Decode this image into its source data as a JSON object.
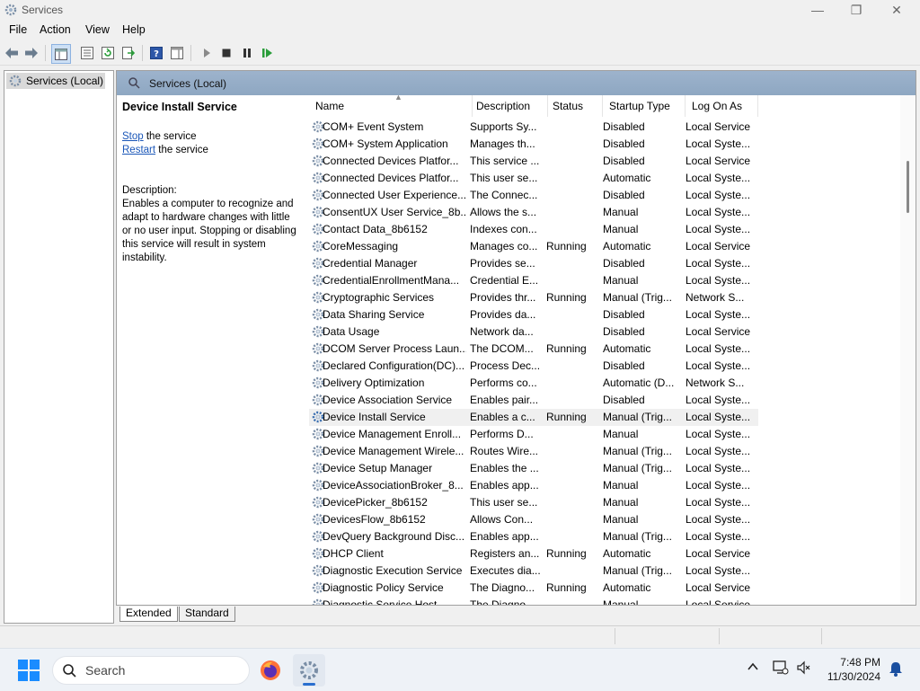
{
  "window": {
    "title": "Services",
    "controls": {
      "minimize": "—",
      "maximize": "❐",
      "close": "✕"
    }
  },
  "menu": [
    "File",
    "Action",
    "View",
    "Help"
  ],
  "tree": {
    "root": "Services (Local)"
  },
  "pane_header": "Services (Local)",
  "details": {
    "service_name": "Device Install Service",
    "stop_link": "Stop",
    "stop_suffix": " the service",
    "restart_link": "Restart",
    "restart_suffix": " the service",
    "description_label": "Description:",
    "description_text": "Enables a computer to recognize and adapt to hardware changes with little or no user input. Stopping or disabling this service will result in system instability."
  },
  "columns": [
    "Name",
    "Description",
    "Status",
    "Startup Type",
    "Log On As"
  ],
  "services": [
    {
      "name": "COM+ Event System",
      "desc": "Supports Sy...",
      "status": "",
      "startup": "Disabled",
      "logon": "Local Service"
    },
    {
      "name": "COM+ System Application",
      "desc": "Manages th...",
      "status": "",
      "startup": "Disabled",
      "logon": "Local Syste..."
    },
    {
      "name": "Connected Devices Platfor...",
      "desc": "This service ...",
      "status": "",
      "startup": "Disabled",
      "logon": "Local Service"
    },
    {
      "name": "Connected Devices Platfor...",
      "desc": "This user se...",
      "status": "",
      "startup": "Automatic",
      "logon": "Local Syste..."
    },
    {
      "name": "Connected User Experience...",
      "desc": "The Connec...",
      "status": "",
      "startup": "Disabled",
      "logon": "Local Syste..."
    },
    {
      "name": "ConsentUX User Service_8b...",
      "desc": "Allows the s...",
      "status": "",
      "startup": "Manual",
      "logon": "Local Syste..."
    },
    {
      "name": "Contact Data_8b6152",
      "desc": "Indexes con...",
      "status": "",
      "startup": "Manual",
      "logon": "Local Syste..."
    },
    {
      "name": "CoreMessaging",
      "desc": "Manages co...",
      "status": "Running",
      "startup": "Automatic",
      "logon": "Local Service"
    },
    {
      "name": "Credential Manager",
      "desc": "Provides se...",
      "status": "",
      "startup": "Disabled",
      "logon": "Local Syste..."
    },
    {
      "name": "CredentialEnrollmentMana...",
      "desc": "Credential E...",
      "status": "",
      "startup": "Manual",
      "logon": "Local Syste..."
    },
    {
      "name": "Cryptographic Services",
      "desc": "Provides thr...",
      "status": "Running",
      "startup": "Manual (Trig...",
      "logon": "Network S..."
    },
    {
      "name": "Data Sharing Service",
      "desc": "Provides da...",
      "status": "",
      "startup": "Disabled",
      "logon": "Local Syste..."
    },
    {
      "name": "Data Usage",
      "desc": "Network da...",
      "status": "",
      "startup": "Disabled",
      "logon": "Local Service"
    },
    {
      "name": "DCOM Server Process Laun...",
      "desc": "The DCOM...",
      "status": "Running",
      "startup": "Automatic",
      "logon": "Local Syste..."
    },
    {
      "name": "Declared Configuration(DC)...",
      "desc": "Process Dec...",
      "status": "",
      "startup": "Disabled",
      "logon": "Local Syste..."
    },
    {
      "name": "Delivery Optimization",
      "desc": "Performs co...",
      "status": "",
      "startup": "Automatic (D...",
      "logon": "Network S..."
    },
    {
      "name": "Device Association Service",
      "desc": "Enables pair...",
      "status": "",
      "startup": "Disabled",
      "logon": "Local Syste..."
    },
    {
      "name": "Device Install Service",
      "desc": "Enables a c...",
      "status": "Running",
      "startup": "Manual (Trig...",
      "logon": "Local Syste..."
    },
    {
      "name": "Device Management Enroll...",
      "desc": "Performs D...",
      "status": "",
      "startup": "Manual",
      "logon": "Local Syste..."
    },
    {
      "name": "Device Management Wirele...",
      "desc": "Routes Wire...",
      "status": "",
      "startup": "Manual (Trig...",
      "logon": "Local Syste..."
    },
    {
      "name": "Device Setup Manager",
      "desc": "Enables the ...",
      "status": "",
      "startup": "Manual (Trig...",
      "logon": "Local Syste..."
    },
    {
      "name": "DeviceAssociationBroker_8...",
      "desc": "Enables app...",
      "status": "",
      "startup": "Manual",
      "logon": "Local Syste..."
    },
    {
      "name": "DevicePicker_8b6152",
      "desc": "This user se...",
      "status": "",
      "startup": "Manual",
      "logon": "Local Syste..."
    },
    {
      "name": "DevicesFlow_8b6152",
      "desc": "Allows Con...",
      "status": "",
      "startup": "Manual",
      "logon": "Local Syste..."
    },
    {
      "name": "DevQuery Background Disc...",
      "desc": "Enables app...",
      "status": "",
      "startup": "Manual (Trig...",
      "logon": "Local Syste..."
    },
    {
      "name": "DHCP Client",
      "desc": "Registers an...",
      "status": "Running",
      "startup": "Automatic",
      "logon": "Local Service"
    },
    {
      "name": "Diagnostic Execution Service",
      "desc": "Executes dia...",
      "status": "",
      "startup": "Manual (Trig...",
      "logon": "Local Syste..."
    },
    {
      "name": "Diagnostic Policy Service",
      "desc": "The Diagno...",
      "status": "Running",
      "startup": "Automatic",
      "logon": "Local Service"
    },
    {
      "name": "Diagnostic Service Host",
      "desc": "The Diagno...",
      "status": "",
      "startup": "Manual",
      "logon": "Local Service"
    }
  ],
  "selected_index": 17,
  "tabs": [
    "Extended",
    "Standard"
  ],
  "taskbar": {
    "search_placeholder": "Search",
    "time": "7:48 PM",
    "date": "11/30/2024"
  },
  "colors": {
    "accent": "#2a6fcf",
    "link": "#1a56b8",
    "pane_header": "#93abc6"
  }
}
